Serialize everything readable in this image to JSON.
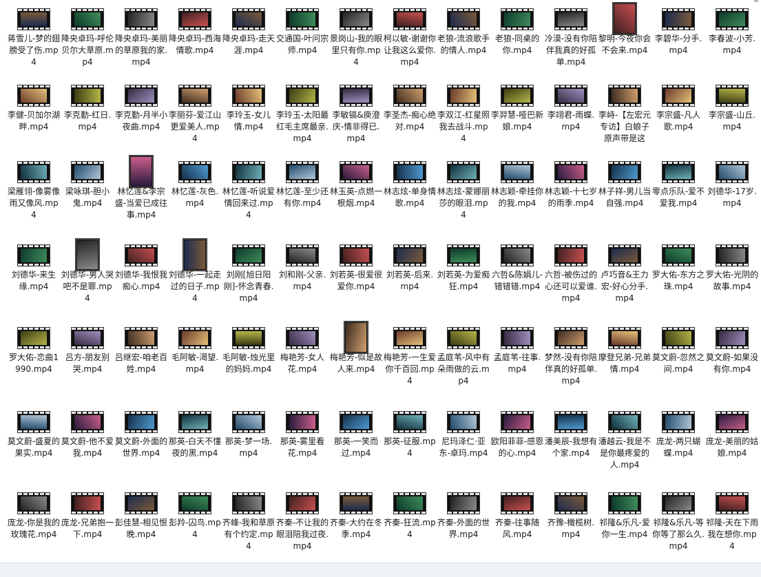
{
  "files": [
    [
      "蒋雪儿-梦的翅膀受了伤.mp4",
      "降央卓玛-呼伦贝尔大草原.mp4",
      "降央卓玛-美丽的草原我的家.mp4",
      "降央卓玛-西海情歌.mp4",
      "降央卓玛-走天涯.mp4",
      "交通国-叶问宗师.mp4",
      "景岗山-我的眼里只有你.mp4",
      "柯以敏-谢谢你让我这么爱你.mp4",
      "老狼-流浪歌手的情人.mp4",
      "老狼-同桌的你.mp4",
      "冷漠-没有你陪伴我真的好孤单.mp4",
      "黎明-今夜你会不会来.mp4",
      "李碧华-分手.mp4",
      "李春波-小芳.mp4"
    ],
    [
      "李健-贝加尔湖畔.mp4",
      "李克勤-红日.mp4",
      "李克勤-月半小夜曲.mp4",
      "李丽芬-爱江山更爱美人.mp4",
      "李玲玉-女儿情.mp4",
      "李玲玉-太阳最红毛主席最亲.mp4",
      "李敏镐&庾澄庆-情非得已.mp4",
      "李圣杰-痴心绝对.mp4",
      "李双江-红星照我去战斗.mp4",
      "李羿慧-哑巴新娘.mp4",
      "李翊君-雨蝶.mp4",
      "李峙-【左宏元专访】白娘子原声带是这样...",
      "李宗盛-凡人歌.mp4",
      "李宗盛-山丘.mp4"
    ],
    [
      "梁雁翎-像雾像雨又像风.mp4",
      "梁咏琪-胆小鬼.mp4",
      "林忆莲&李宗盛-当爱已成往事.mp4",
      "林忆莲-灰色.mp4",
      "林忆莲-听说爱情回来过.mp4",
      "林忆莲-至少还有你.mp4",
      "林玉英-点燃一根烟.mp4",
      "林志炫-单身情歌.mp4",
      "林志炫-蒙娜丽莎的眼泪.mp4",
      "林志颖-牵挂你的我.mp4",
      "林志颖-十七岁的雨季.mp4",
      "林子祥-男儿当自强.mp4",
      "零点乐队-爱不爱我.mp4",
      "刘德华-17岁.mp4"
    ],
    [
      "刘德华-来生缘.mp4",
      "刘德华-男人哭吧不是罪.mp4",
      "刘德华-我恨我痴心.mp4",
      "刘德华-一起走过的日子.mp4",
      "刘刚[旭日阳刚]-怀念青春.mp4",
      "刘和刚-父亲.mp4",
      "刘若英-很爱很爱你.mp4",
      "刘若英-后来.mp4",
      "刘若英-为爱痴狂.mp4",
      "六哲&陈娟儿-错错错.mp4",
      "六哲-被伤过的心还可以爱谁.mp4",
      "卢巧音&王力宏-好心分手.mp4",
      "罗大佑-东方之珠.mp4",
      "罗大佑-光阴的故事.mp4"
    ],
    [
      "罗大佑-恋曲1990.mp4",
      "吕方-朋友别哭.mp4",
      "吕继宏-咱老百姓.mp4",
      "毛阿敏-渴望.mp4",
      "毛阿敏-烛光里的妈妈.mp4",
      "梅艳芳-女人花.mp4",
      "梅艳芳-似是故人来.mp4",
      "梅艳芳-一生爱你千百回.mp4",
      "孟庭苇-风中有朵雨做的云.mp4",
      "孟庭苇-往事.mp4",
      "梦然-没有你陪伴真的好孤单.mp4",
      "摩登兄弟-兄弟情.mp4",
      "莫文蔚-忽然之间.mp4",
      "莫文蔚-如果没有你.mp4"
    ],
    [
      "莫文蔚-盛夏的果实.mp4",
      "莫文蔚-他不爱我.mp4",
      "莫文蔚-外面的世界.mp4",
      "那英-白天不懂夜的黑.mp4",
      "那英-梦一场.mp4",
      "那英-雾里看花.mp4",
      "那英-一笑而过.mp4",
      "那英-征服.mp4",
      "尼玛泽仁·亚东-卓玛.mp4",
      "欧阳菲菲-感恩的心.mp4",
      "潘美辰-我想有个家.mp4",
      "潘越云-我是不是你最疼爱的人.mp4",
      "庞龙-两只蝴蝶.mp4",
      "庞龙-美丽的姑娘.mp4"
    ],
    [
      "庞龙-你是我的玫瑰花.mp4",
      "庞龙-兄弟抱一下.mp4",
      "彭佳慧-相见恨晚.mp4",
      "彭羚-囚鸟.mp4",
      "齐峰-我和草原有个约定.mp4",
      "齐秦-不让我的眼泪陪我过夜.mp4",
      "齐秦-大约在冬季.mp4",
      "齐秦-狂流.mp4",
      "齐秦-外面的世界.mp4",
      "齐秦-往事随风.mp4",
      "齐豫-橄榄树.mp4",
      "祁隆&乐凡-爱你一生.mp4",
      "祁隆&乐凡-等你等了那么久.mp4",
      "祁隆-天在下雨我在想你.mp4"
    ]
  ]
}
